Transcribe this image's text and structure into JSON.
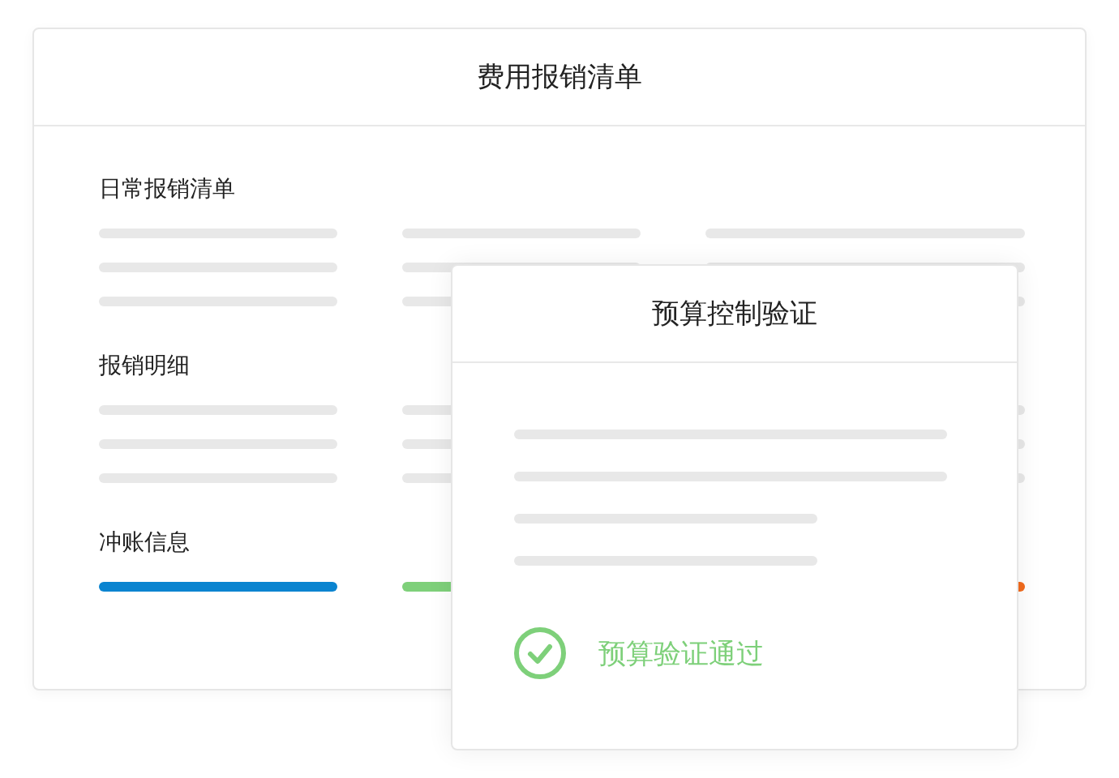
{
  "main_card": {
    "title": "费用报销清单",
    "sections": [
      {
        "title": "日常报销清单",
        "kind": "skeleton"
      },
      {
        "title": "报销明细",
        "kind": "skeleton"
      },
      {
        "title": "冲账信息",
        "kind": "bars",
        "bars": [
          {
            "color": "#0a84d0"
          },
          {
            "color": "#7ed07a"
          },
          {
            "color": "#f26b1d"
          }
        ]
      }
    ]
  },
  "dialog": {
    "title": "预算控制验证",
    "status": "预算验证通过"
  }
}
